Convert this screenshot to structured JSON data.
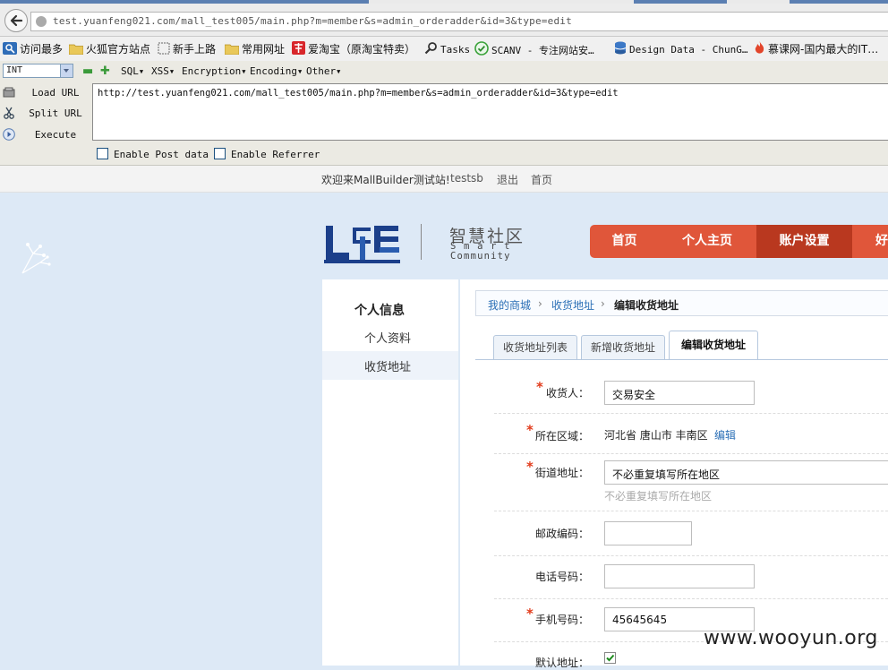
{
  "browser": {
    "address_url": "test.yuanfeng021.com/mall_test005/main.php?m=member&s=admin_orderadder&id=3&type=edit",
    "bookmarks": [
      "访问最多",
      "火狐官方站点",
      "新手上路",
      "常用网址",
      "爱淘宝（原淘宝特卖）",
      "Tasks",
      "SCANV - 专注网站安…",
      "Design Data - ChunG…",
      "慕课网-国内最大的IT…"
    ]
  },
  "hackbar": {
    "type_select": "INT",
    "menus": [
      "SQL",
      "XSS",
      "Encryption",
      "Encoding",
      "Other"
    ],
    "load_url": "Load URL",
    "split_url": "Split URL",
    "execute": "Execute",
    "url_text": "http://test.yuanfeng021.com/mall_test005/main.php?m=member&s=admin_orderadder&id=3&type=edit",
    "enable_post": "Enable Post data",
    "enable_referrer": "Enable Referrer"
  },
  "topbar": {
    "welcome": "欢迎来MallBuilder测试站!",
    "user": "testsb",
    "logout": "退出",
    "home": "首页"
  },
  "logo": {
    "cn": "智慧社区",
    "en_line1": "S m a r t",
    "en_line2": "Community"
  },
  "nav": [
    "首页",
    "个人主页",
    "账户设置",
    "好"
  ],
  "sidebar": {
    "title": "个人信息",
    "items": [
      "个人资料",
      "收货地址"
    ]
  },
  "breadcrumb": {
    "root": "我的商城",
    "level2": "收货地址",
    "current": "编辑收货地址"
  },
  "tabs": [
    "收货地址列表",
    "新增收货地址",
    "编辑收货地址"
  ],
  "form": {
    "receiver_label": "收货人：",
    "receiver_value": "交易安全",
    "region_label": "所在区域：",
    "region_value": "河北省 唐山市 丰南区",
    "region_edit": "编辑",
    "street_label": "街道地址：",
    "street_value": "不必重复填写所在地区",
    "street_hint": "不必重复填写所在地区",
    "zip_label": "邮政编码：",
    "zip_value": "",
    "tel_label": "电话号码：",
    "tel_value": "",
    "mobile_label": "手机号码：",
    "mobile_value": "45645645",
    "default_label": "默认地址：",
    "default_checked": true
  },
  "watermark": "www.wooyun.org",
  "colors": {
    "nav_bg": "#e0563a",
    "nav_active": "#b9381f",
    "required": "#e23b1b",
    "link": "#2b6fb6",
    "page_bg": "#dde9f6"
  }
}
